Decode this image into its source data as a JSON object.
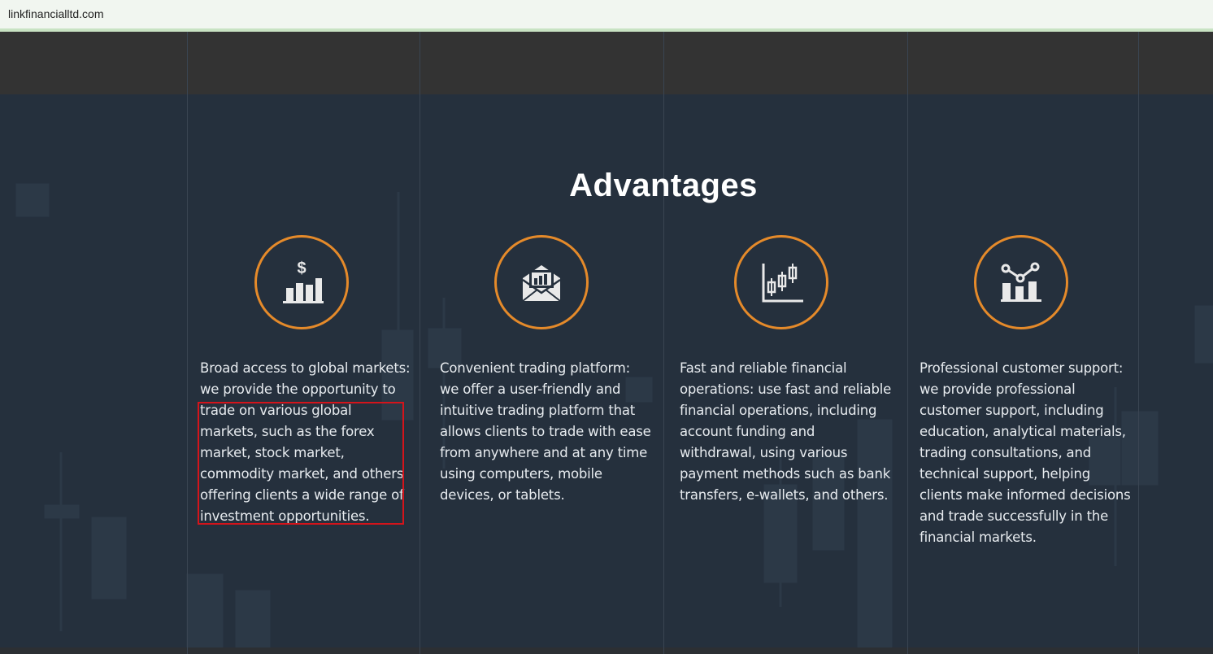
{
  "browser": {
    "url": "linkfinancialltd.com"
  },
  "section": {
    "title": "Advantages",
    "accent_color": "#e58a2a",
    "advantages": [
      {
        "icon": "dollar-bar-chart-icon",
        "text": "Broad access to global markets: we provide the opportunity to trade on various global markets, such as the forex market, stock market, commodity market, and others offering clients a wide range of investment opportunities."
      },
      {
        "icon": "envelope-chart-icon",
        "text": "Convenient trading platform: we offer a user-friendly and intuitive trading platform that allows clients to trade with ease from anywhere and at any time using computers, mobile devices, or tablets."
      },
      {
        "icon": "candlestick-chart-icon",
        "text": "Fast and reliable financial operations: use fast and reliable financial operations, including account funding and withdrawal, using various payment methods such as bank transfers, e-wallets, and others."
      },
      {
        "icon": "analytics-chart-icon",
        "text": "Professional customer support: we provide professional customer support, including education, analytical materials, trading consultations, and technical support, helping clients make informed decisions and trade successfully in the financial markets."
      }
    ]
  },
  "annotation": {
    "color": "#d4141b"
  }
}
